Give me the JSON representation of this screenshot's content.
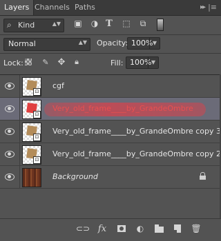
{
  "tabs": [
    {
      "label": "Layers",
      "active": true
    },
    {
      "label": "Channels",
      "active": false
    },
    {
      "label": "Paths",
      "active": false
    }
  ],
  "filter": {
    "kind_label": "Kind",
    "icons": [
      "image-filter-icon",
      "adjustment-filter-icon",
      "type-filter-icon",
      "shape-filter-icon",
      "smart-object-filter-icon"
    ]
  },
  "blend": {
    "mode": "Normal",
    "opacity_label": "Opacity:",
    "opacity_value": "100%"
  },
  "lock": {
    "label": "Lock:",
    "fill_label": "Fill:",
    "fill_value": "100%"
  },
  "layers": [
    {
      "name": "cgf",
      "visible": true,
      "selected": false,
      "thumb": "checker"
    },
    {
      "name": "Very_old_frame____by_GrandeOmbre",
      "visible": true,
      "selected": true,
      "thumb": "checker-red"
    },
    {
      "name": "Very_old_frame____by_GrandeOmbre copy 3",
      "visible": true,
      "selected": false,
      "thumb": "checker"
    },
    {
      "name": "Very_old_frame____by_GrandeOmbre copy 2",
      "visible": true,
      "selected": false,
      "thumb": "checker"
    },
    {
      "name": "Background",
      "visible": true,
      "selected": false,
      "thumb": "wood",
      "locked": true
    }
  ],
  "colors": {
    "panel_bg": "#535353",
    "selected_row": "#6b6b78",
    "selected_text": "#e85050",
    "highlight_streak": "#e63c46"
  },
  "bottom_buttons": [
    "link-layers-icon",
    "fx-icon",
    "layer-mask-icon",
    "adjustment-layer-icon",
    "group-folder-icon",
    "new-layer-icon",
    "trash-icon"
  ]
}
